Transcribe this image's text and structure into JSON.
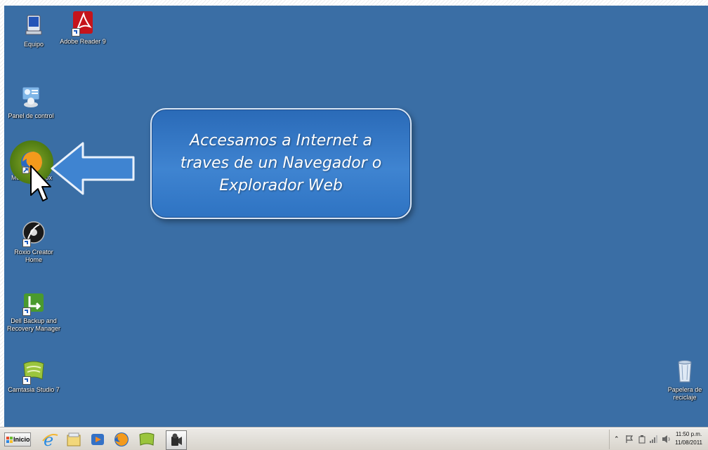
{
  "desktop_icons": [
    {
      "label": "Equipo"
    },
    {
      "label": "Adobe Reader 9"
    },
    {
      "label": "Panel de control"
    },
    {
      "label": "Mozilla Firefox"
    },
    {
      "label": "Roxio Creator Home"
    },
    {
      "label": "Dell Backup and Recovery Manager"
    },
    {
      "label": "Camtasia Studio 7"
    },
    {
      "label": "Papelera de reciclaje"
    }
  ],
  "callout": {
    "line1": "Accesamos a Internet a",
    "line2": "traves de un Navegador o",
    "line3": "Explorador Web"
  },
  "taskbar": {
    "start_label": "Inicio",
    "pinned": [
      "ie-icon",
      "explorer-icon",
      "media-player-icon",
      "firefox-icon",
      "camtasia-icon",
      "recorder-icon"
    ]
  },
  "tray": {
    "time": "11:50 p.m.",
    "date": "11/08/2011"
  },
  "colors": {
    "desktop": "#3a6ea5",
    "callout": "#3f84d1",
    "arrow_fill": "#3f84d1"
  }
}
